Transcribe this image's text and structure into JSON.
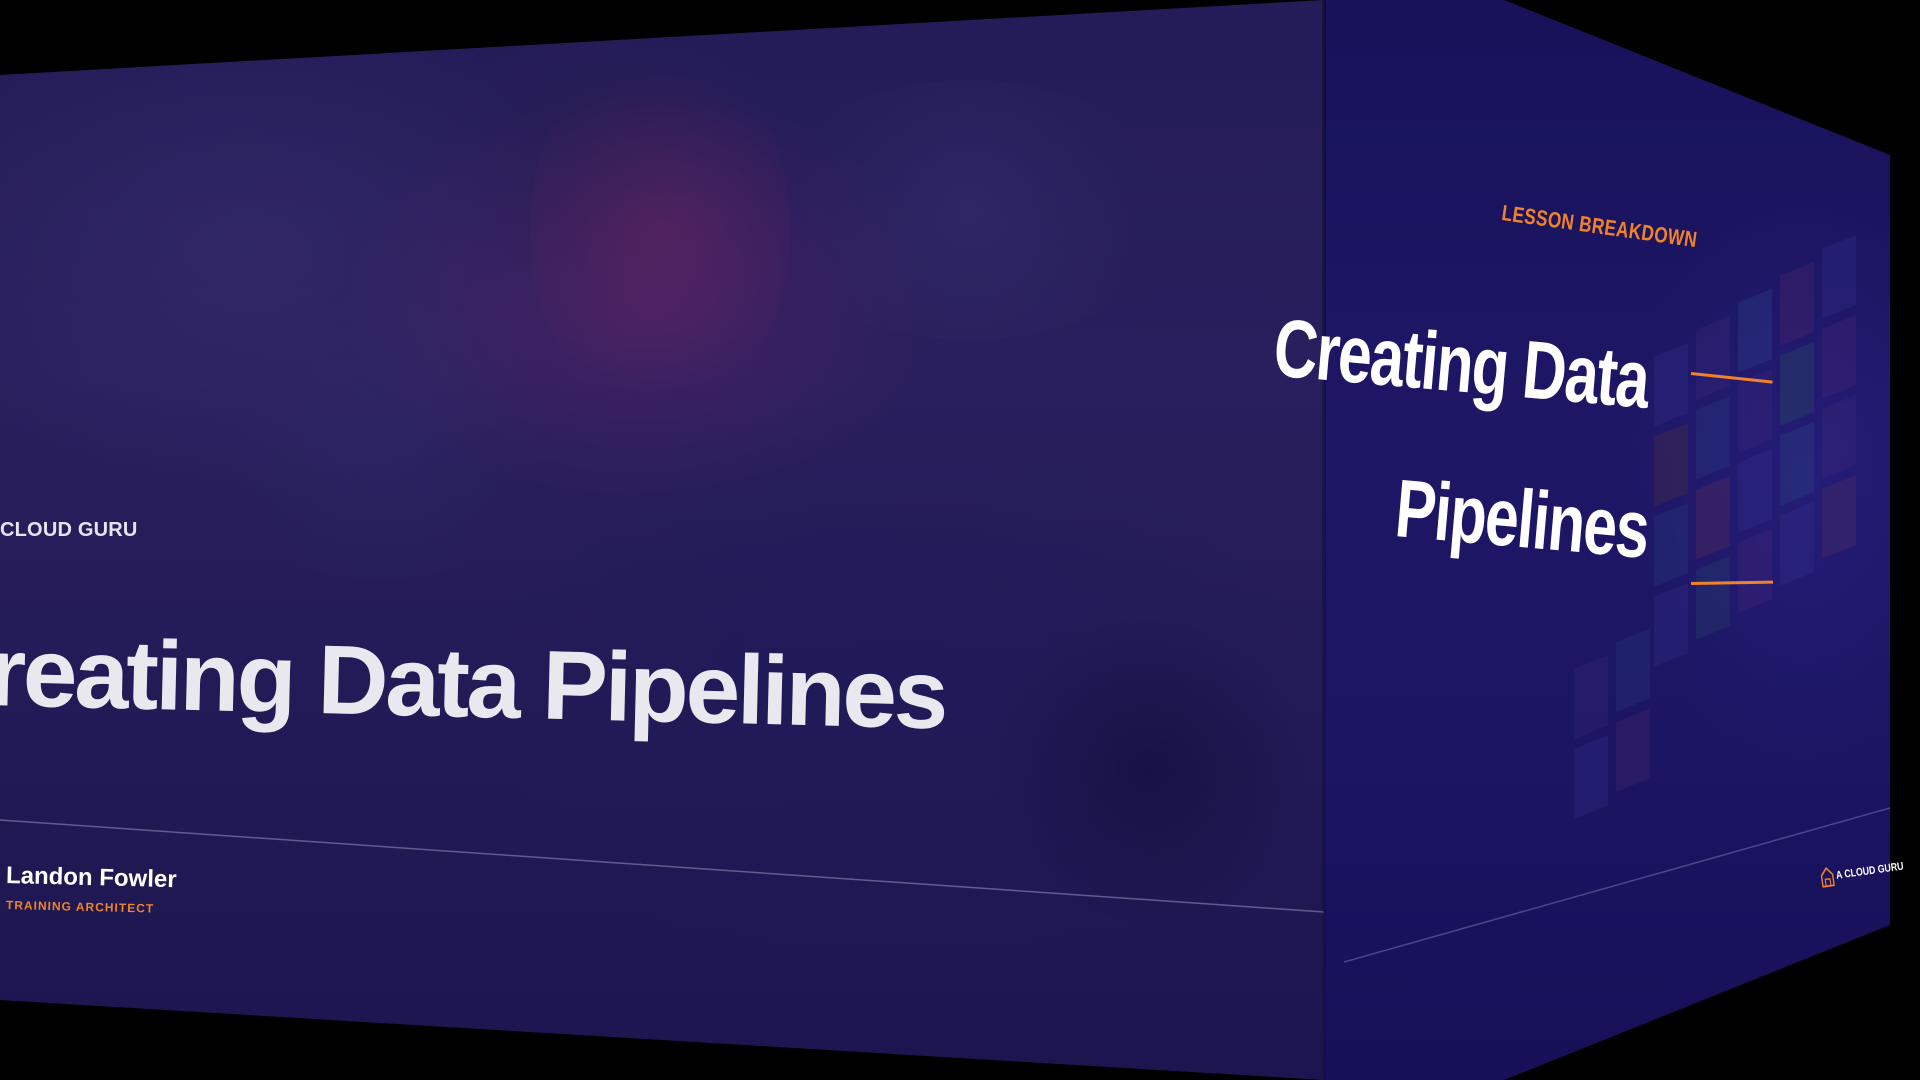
{
  "colors": {
    "background": "#000000",
    "left_face": "#241d5a",
    "right_face": "#1c1662",
    "accent": "#f0832a",
    "title_text": "#e8e8ee",
    "white": "#ffffff"
  },
  "left_slide": {
    "brand": "CLOUD GURU",
    "title": "reating Data Pipelines",
    "presenter": {
      "name": "Landon Fowler",
      "role": "TRAINING ARCHITECT"
    }
  },
  "right_slide": {
    "label": "LESSON BREAKDOWN",
    "title_lines": [
      "Creating Data",
      "Pipelines"
    ],
    "logo": {
      "icon": "cloud-guru-logo-icon",
      "text": "A CLOUD GURU"
    }
  }
}
